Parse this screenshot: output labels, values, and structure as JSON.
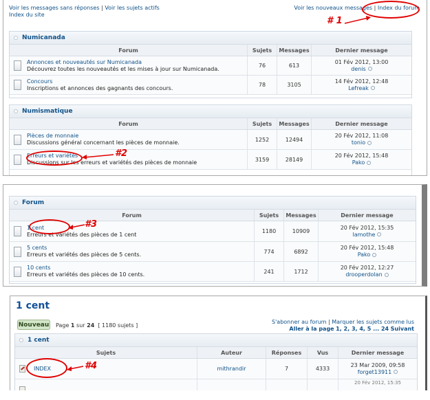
{
  "panel1": {
    "links_left": [
      "Voir les messages sans réponses",
      "Voir les sujets actifs",
      "Index du site"
    ],
    "links_right": [
      "Voir les nouveaux messages",
      "Index du forum"
    ],
    "separator": "|",
    "annotation": "# 1",
    "categories": [
      {
        "title": "Numicanada",
        "headers": {
          "forum": "Forum",
          "sujets": "Sujets",
          "messages": "Messages",
          "dernier": "Dernier message"
        },
        "rows": [
          {
            "name": "Annonces et nouveautés sur Numicanada",
            "desc": "Découvrez toutes les nouveautés et les mises à jour sur Numicanada.",
            "sujets": "76",
            "messages": "613",
            "date": "01 Fév 2012, 13:00",
            "user": "denis"
          },
          {
            "name": "Concours",
            "desc": "Inscriptions et annonces des gagnants des concours.",
            "sujets": "78",
            "messages": "3105",
            "date": "14 Fév 2012, 12:48",
            "user": "Lefreak"
          }
        ]
      },
      {
        "title": "Numismatique",
        "headers": {
          "forum": "Forum",
          "sujets": "Sujets",
          "messages": "Messages",
          "dernier": "Dernier message"
        },
        "rows": [
          {
            "name": "Pièces de monnaie",
            "desc": "Discussions général concernant les pièces de monnaie.",
            "sujets": "1252",
            "messages": "12494",
            "date": "20 Fév 2012, 11:08",
            "user": "tonio"
          },
          {
            "name": "Erreurs et variétés",
            "desc": "Discussions sur les erreurs et variétés des pièces de monnaie",
            "sujets": "3159",
            "messages": "28149",
            "date": "20 Fév 2012, 15:48",
            "user": "Pako"
          }
        ]
      }
    ],
    "annotation2": "#2"
  },
  "panel2": {
    "title": "Forum",
    "headers": {
      "forum": "Forum",
      "sujets": "Sujets",
      "messages": "Messages",
      "dernier": "Dernier message"
    },
    "rows": [
      {
        "name": "1 cent",
        "desc": "Erreurs et variétés des pièces de 1 cent",
        "sujets": "1180",
        "messages": "10909",
        "date": "20 Fév 2012, 15:35",
        "user": "lamothe"
      },
      {
        "name": "5 cents",
        "desc": "Erreurs et variétés des pièces de 5 cents.",
        "sujets": "774",
        "messages": "6892",
        "date": "20 Fév 2012, 15:48",
        "user": "Pako"
      },
      {
        "name": "10 cents",
        "desc": "Erreurs et variétés des pièces de 10 cents.",
        "sujets": "241",
        "messages": "1712",
        "date": "20 Fév 2012, 12:27",
        "user": "drooperdolan"
      }
    ],
    "annotation": "#3"
  },
  "panel3": {
    "page_title": "1 cent",
    "new_button": "Nouveau",
    "page_info_prefix": "Page",
    "page_current": "1",
    "page_info_mid": "sur",
    "page_total": "24",
    "topic_count": "[ 1180 sujets ]",
    "subscribe": "S'abonner au forum",
    "mark_read": "Marquer les sujets comme lus",
    "goto_prefix": "Aller à la page",
    "goto_pages": "1, 2, 3, 4, 5 ... 24",
    "next": "Suivant",
    "box_title": "1 cent",
    "headers": {
      "sujets": "Sujets",
      "auteur": "Auteur",
      "reponses": "Réponses",
      "vus": "Vus",
      "dernier": "Dernier message"
    },
    "rows": [
      {
        "title": "INDEX",
        "auteur": "mithrandir",
        "reponses": "7",
        "vus": "4333",
        "date": "23 Mar 2009, 09:58",
        "user": "forget13911"
      }
    ],
    "partial_date": "20 Fév 2012, 15:35",
    "annotation": "#4"
  },
  "colors": {
    "link": "#105289",
    "annotation": "#e00000",
    "new_button_bg": "#d4e6c9"
  }
}
